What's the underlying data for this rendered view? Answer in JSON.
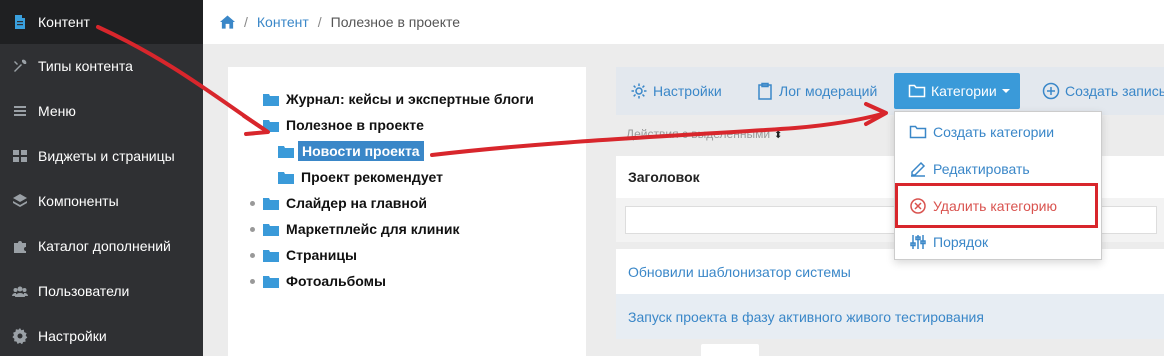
{
  "sidebar": {
    "items": [
      {
        "label": "Контент",
        "icon": "document-icon",
        "active": true
      },
      {
        "label": "Типы контента",
        "icon": "tools-icon"
      },
      {
        "label": "Меню",
        "icon": "menu-icon"
      },
      {
        "label": "Виджеты и страницы",
        "icon": "grid-icon"
      },
      {
        "label": "Компоненты",
        "icon": "layers-icon"
      },
      {
        "label": "Каталог дополнений",
        "icon": "puzzle-icon"
      },
      {
        "label": "Пользователи",
        "icon": "users-icon"
      },
      {
        "label": "Настройки",
        "icon": "gear-icon"
      }
    ]
  },
  "breadcrumb": {
    "home_icon": "home-icon",
    "sep": "/",
    "content_link": "Контент",
    "current": "Полезное в проекте"
  },
  "tree": {
    "items": [
      {
        "label": "Журнал: кейсы и экспертные блоги",
        "level": 0
      },
      {
        "label": "Полезное в проекте",
        "level": 0
      },
      {
        "label": "Новости проекта",
        "level": 1,
        "selected": true
      },
      {
        "label": "Проект рекомендует",
        "level": 1
      },
      {
        "label": "Слайдер на главной",
        "level": 0,
        "bullet": true
      },
      {
        "label": "Маркетплейс для клиник",
        "level": 0,
        "bullet": true
      },
      {
        "label": "Страницы",
        "level": 0,
        "bullet": true
      },
      {
        "label": "Фотоальбомы",
        "level": 0,
        "bullet": true
      }
    ]
  },
  "toolbar": {
    "settings": "Настройки",
    "moderation_log": "Лог модераций",
    "categories": "Категории",
    "create_entry": "Создать запись"
  },
  "mass_action": {
    "label": "Действия с выделенными",
    "sort_icon": "sort-icon"
  },
  "table": {
    "header": "Заголовок",
    "rows": [
      "Обновили шаблонизатор системы",
      "Запуск проекта в фазу активного живого тестирования"
    ]
  },
  "dropdown": {
    "items": [
      {
        "label": "Создать категории",
        "icon": "folder-icon"
      },
      {
        "label": "Редактировать",
        "icon": "edit-icon"
      },
      {
        "label": "Удалить категорию",
        "icon": "remove-circle-icon",
        "danger": true
      },
      {
        "label": "Порядок",
        "icon": "sliders-icon"
      }
    ]
  },
  "colors": {
    "accent": "#3a87c8",
    "primary_button": "#3a9ad9",
    "danger": "#d9534f",
    "annotation_red": "#d8262c",
    "sidebar_bg": "#2f3033"
  }
}
